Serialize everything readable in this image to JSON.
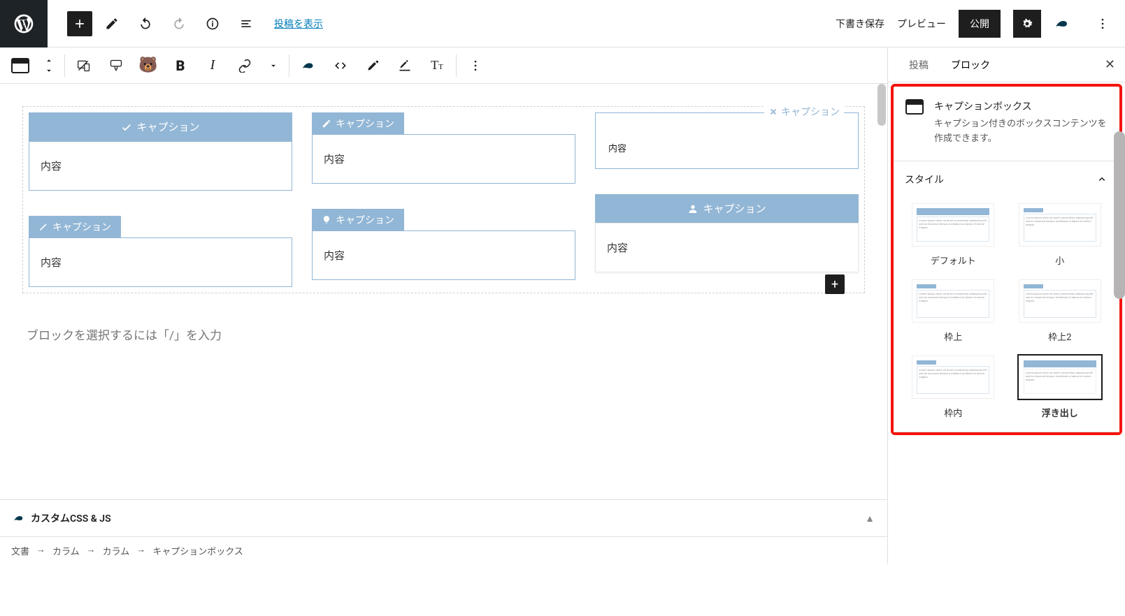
{
  "topbar": {
    "view_post": "投稿を表示",
    "save_draft": "下書き保存",
    "preview": "プレビュー",
    "publish": "公開"
  },
  "caption_boxes": {
    "col1": [
      {
        "caption": "キャプション",
        "content": "内容",
        "style": "default",
        "icon": "check"
      },
      {
        "caption": "キャプション",
        "content": "内容",
        "style": "small",
        "icon": "pen"
      }
    ],
    "col2": [
      {
        "caption": "キャプション",
        "content": "内容",
        "style": "small",
        "icon": "edit"
      },
      {
        "caption": "キャプション",
        "content": "内容",
        "style": "small",
        "icon": "bulb"
      }
    ],
    "col3": [
      {
        "caption": "キャプション",
        "content": "内容",
        "style": "x",
        "icon": "x"
      },
      {
        "caption": "キャプション",
        "content": "内容",
        "style": "float-full",
        "icon": "user"
      }
    ]
  },
  "block_prompt": "ブロックを選択するには「/」を入力",
  "custom_panel": {
    "title": "カスタムCSS & JS"
  },
  "breadcrumb": [
    "文書",
    "カラム",
    "カラム",
    "キャプションボックス"
  ],
  "sidebar": {
    "tab_post": "投稿",
    "tab_block": "ブロック",
    "block_title": "キャプションボックス",
    "block_desc": "キャプション付きのボックスコンテンツを作成できます。",
    "section_style": "スタイル",
    "styles": [
      {
        "label": "デフォルト",
        "variant": "default"
      },
      {
        "label": "小",
        "variant": "small"
      },
      {
        "label": "枠上",
        "variant": "top"
      },
      {
        "label": "枠上2",
        "variant": "top2"
      },
      {
        "label": "枠内",
        "variant": "inner"
      },
      {
        "label": "浮き出し",
        "variant": "float",
        "selected": true
      }
    ]
  }
}
